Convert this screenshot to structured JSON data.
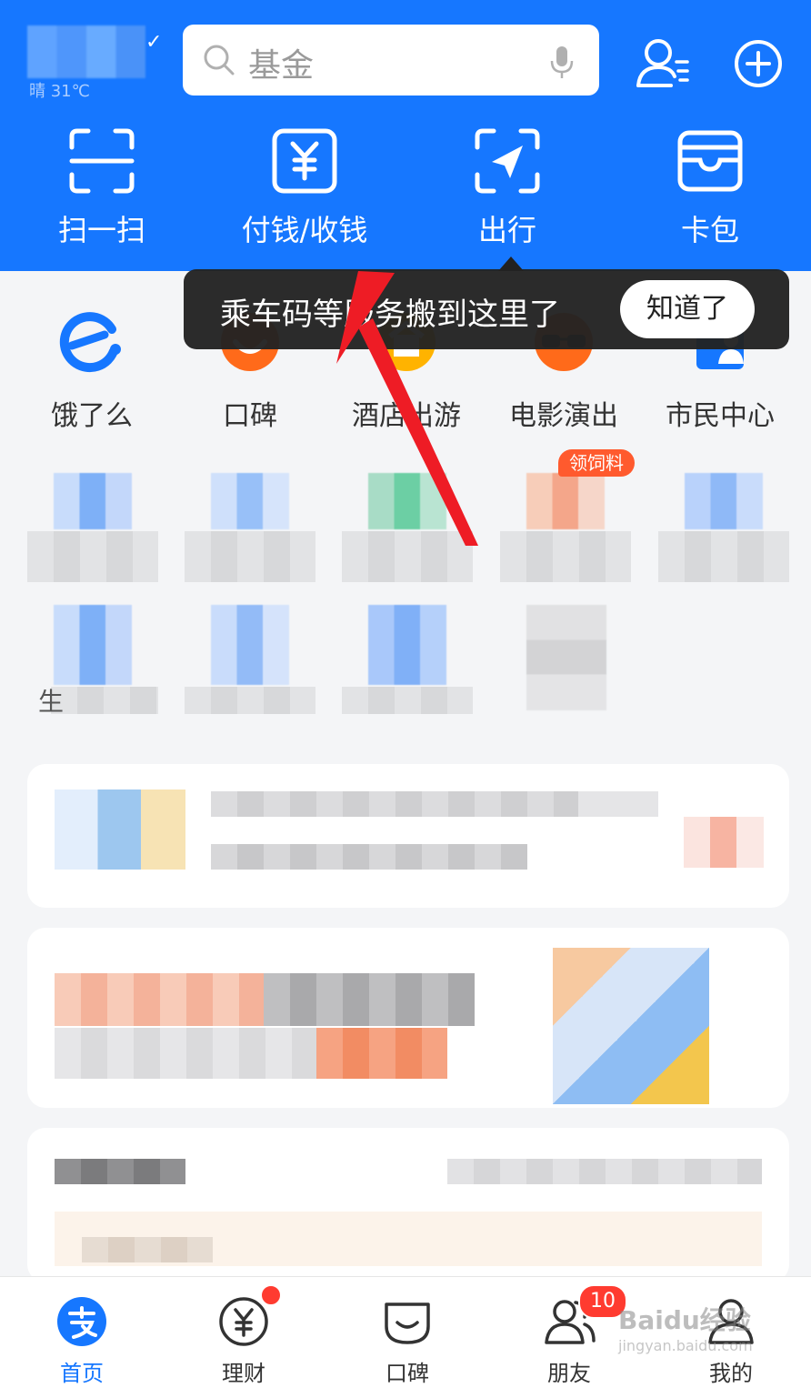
{
  "header": {
    "weather": "晴 31℃",
    "search_placeholder": "基金",
    "quick_actions": [
      {
        "label": "扫一扫",
        "icon": "scan-icon"
      },
      {
        "label": "付钱/收钱",
        "icon": "pay-receive-icon"
      },
      {
        "label": "出行",
        "icon": "travel-icon"
      },
      {
        "label": "卡包",
        "icon": "card-wallet-icon"
      }
    ]
  },
  "tooltip": {
    "message": "乘车码等服务搬到这里了",
    "button": "知道了"
  },
  "services": [
    {
      "label": "饿了么",
      "icon": "eleme-icon"
    },
    {
      "label": "口碑",
      "icon": "koubei-icon"
    },
    {
      "label": "酒店出游",
      "icon": "hotel-travel-icon"
    },
    {
      "label": "电影演出",
      "icon": "movie-show-icon"
    },
    {
      "label": "市民中心",
      "icon": "citizen-center-icon"
    }
  ],
  "grid_badge": "领饲料",
  "row3_first_char": "生",
  "tabbar": {
    "tabs": [
      {
        "label": "首页",
        "icon": "alipay-home-icon",
        "active": true
      },
      {
        "label": "理财",
        "icon": "finance-icon",
        "dot": true
      },
      {
        "label": "口碑",
        "icon": "koubei-tab-icon"
      },
      {
        "label": "朋友",
        "icon": "friends-icon",
        "badge": "10"
      },
      {
        "label": "我的",
        "icon": "profile-icon"
      }
    ]
  },
  "watermark": {
    "brand": "Baidu经验",
    "url": "jingyan.baidu.com"
  },
  "colors": {
    "primary": "#1677ff",
    "badge": "#ff3b30",
    "arrow": "#ee1c25"
  }
}
